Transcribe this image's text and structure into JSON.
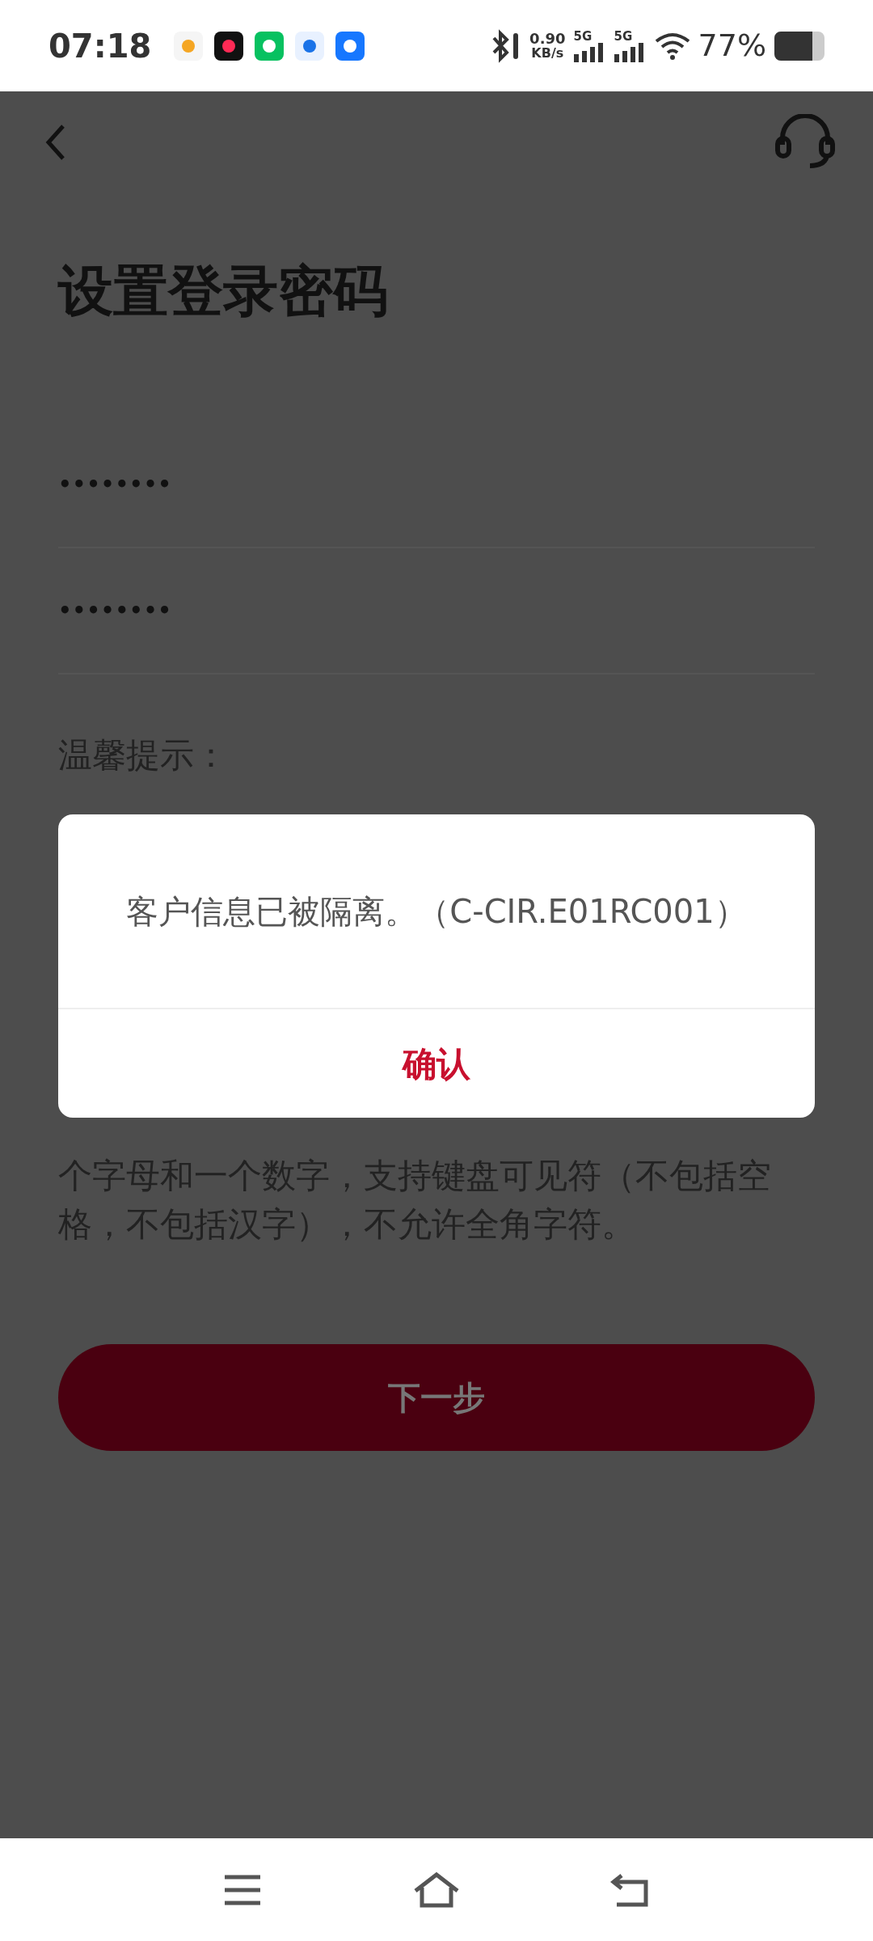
{
  "status_bar": {
    "time": "07:18",
    "speed_value": "0.90",
    "speed_unit": "KB/s",
    "network_1": "5G",
    "network_2": "5G",
    "battery": "77%"
  },
  "header": {
    "title": "设置登录密码"
  },
  "fields": [
    {
      "value": "••••••••"
    },
    {
      "value": "••••••••"
    }
  ],
  "hints": {
    "heading": "温馨提示：",
    "lines": [
      "个字母和一个数字，支持键盘可见符（不包括空",
      "格，不包括汉字），不允许全角字符。"
    ]
  },
  "next_button": {
    "label": "下一步",
    "disabled": true
  },
  "dialog": {
    "message": "客户信息已被隔离。（C-CIR.E01RC001）",
    "confirm": "确认"
  }
}
